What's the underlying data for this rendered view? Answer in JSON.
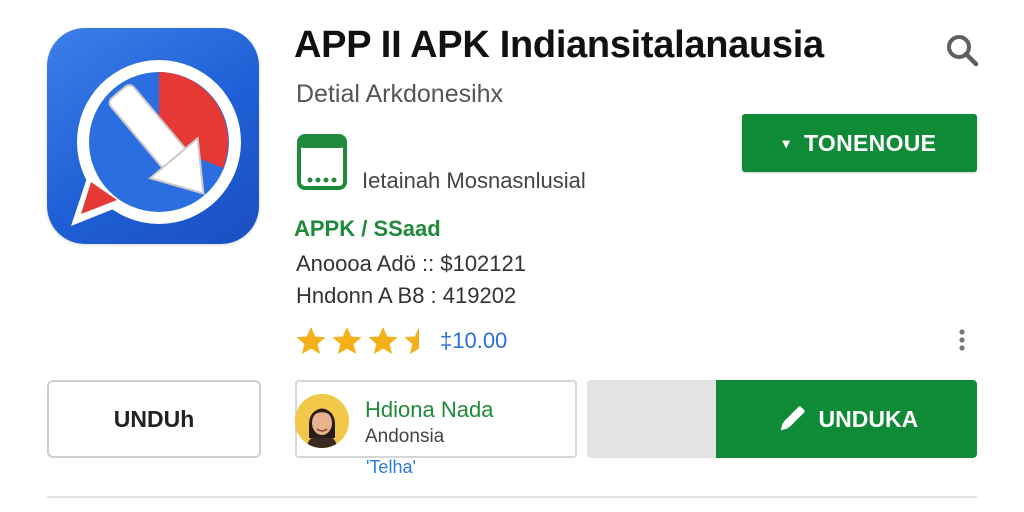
{
  "app": {
    "title": "APP II APK Indiansitalanausia",
    "subtitle": "Detial Arkdonesihx",
    "calendar_label": "Ietainah Mosnasnlusial",
    "category": "APPK / SSaad",
    "info_line_1": "Anoooa Adö :: $102121",
    "info_line_2": "Hndonn A B8 : 419202"
  },
  "header": {
    "search_icon": "search-icon",
    "install_button_label": "TONENOUE",
    "install_button_caret": "▾"
  },
  "rating": {
    "stars": 3.5,
    "max_stars": 4,
    "text": "‡10.00",
    "star_color": "#f3b019"
  },
  "actions": {
    "unduh_label": "UNDUh",
    "download_label": "UNDUKA",
    "download_progress": 0.67
  },
  "developer": {
    "name": "Hdiona Nada",
    "country": "Andonsia",
    "link": "'Telha'"
  },
  "colors": {
    "accent_green": "#0f8a36",
    "link_blue": "#2c7be0",
    "icon_blue": "#1f5fd6",
    "icon_red": "#e53935"
  }
}
